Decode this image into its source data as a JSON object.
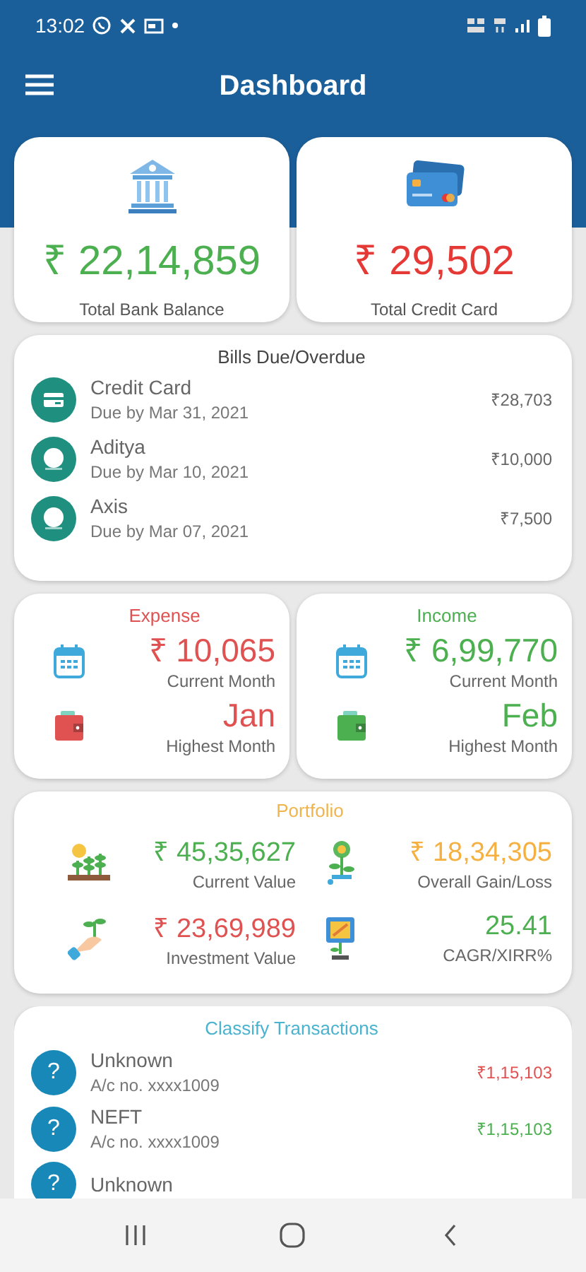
{
  "status_bar": {
    "time": "13:02"
  },
  "app_bar": {
    "title": "Dashboard"
  },
  "summary": [
    {
      "kind": "bank",
      "amount": "₹ 22,14,859",
      "label": "Total Bank Balance",
      "color": "#4caf50"
    },
    {
      "kind": "card",
      "amount": "₹ 29,502",
      "label": "Total Credit Card",
      "color": "#e53935"
    }
  ],
  "bills": {
    "title": "Bills Due/Overdue",
    "items": [
      {
        "kind": "card",
        "name": "Credit Card",
        "due": "Due by Mar 31, 2021",
        "amount": "₹28,703"
      },
      {
        "kind": "logo",
        "name": "Aditya",
        "due": "Due by Mar 10, 2021",
        "amount": "₹10,000"
      },
      {
        "kind": "logo",
        "name": "Axis",
        "due": "Due by Mar 07, 2021",
        "amount": "₹7,500"
      }
    ]
  },
  "flows": [
    {
      "title": "Expense",
      "color": "#e05252",
      "current": "₹ 10,065",
      "current_label": "Current Month",
      "highest": "Jan",
      "highest_label": "Highest Month"
    },
    {
      "title": "Income",
      "color": "#4caf50",
      "current": "₹ 6,99,770",
      "current_label": "Current Month",
      "highest": "Feb",
      "highest_label": "Highest Month"
    }
  ],
  "portfolio": {
    "title": "Portfolio",
    "metrics": [
      {
        "kind": "plants",
        "value": "₹ 45,35,627",
        "label": "Current Value",
        "color": "#4caf50"
      },
      {
        "kind": "sprout",
        "value": "₹ 18,34,305",
        "label": "Overall Gain/Loss",
        "color": "#f5b041"
      },
      {
        "kind": "hand",
        "value": "₹ 23,69,989",
        "label": "Investment Value",
        "color": "#e05252"
      },
      {
        "kind": "sign",
        "value": "25.41",
        "label": "CAGR/XIRR%",
        "color": "#4caf50"
      }
    ]
  },
  "transactions": {
    "title": "Classify Transactions",
    "items": [
      {
        "icon": "?",
        "name": "Unknown",
        "account": "A/c no. xxxx1009",
        "amount": "₹1,15,103",
        "color": "#e05252"
      },
      {
        "icon": "?",
        "name": "NEFT",
        "account": "A/c no. xxxx1009",
        "amount": "₹1,15,103",
        "color": "#4caf50"
      },
      {
        "icon": "?",
        "name": "Unknown"
      }
    ]
  }
}
